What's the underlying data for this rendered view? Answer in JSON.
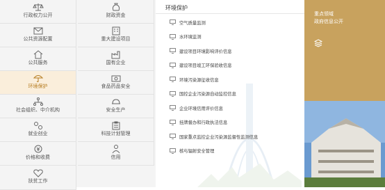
{
  "grid": [
    {
      "label": "行政权力公开",
      "icon": "scale-icon",
      "active": false
    },
    {
      "label": "财政资金",
      "icon": "money-bag-icon",
      "active": false
    },
    {
      "label": "公共资源配置",
      "icon": "envelope-icon",
      "active": false
    },
    {
      "label": "重大建设项目",
      "icon": "building-icon",
      "active": false
    },
    {
      "label": "公共服务",
      "icon": "house-icon",
      "active": false
    },
    {
      "label": "国有企业",
      "icon": "factory-icon",
      "active": false
    },
    {
      "label": "环境保护",
      "icon": "umbrella-icon",
      "active": true
    },
    {
      "label": "食品药品安全",
      "icon": "camera-icon",
      "active": false
    },
    {
      "label": "社会组织、中介机构",
      "icon": "network-icon",
      "active": false
    },
    {
      "label": "安全生产",
      "icon": "hard-hat-icon",
      "active": false
    },
    {
      "label": "就业创业",
      "icon": "gears-icon",
      "active": false
    },
    {
      "label": "科技计划管理",
      "icon": "clipboard-icon",
      "active": false
    },
    {
      "label": "价格和收费",
      "icon": "price-tag-icon",
      "active": false
    },
    {
      "label": "信用",
      "icon": "person-icon",
      "active": false
    },
    {
      "label": "扶贫工作",
      "icon": "heart-icon",
      "active": false
    }
  ],
  "panel": {
    "title": "环境保护",
    "items": [
      "空气质量监测",
      "水环境监测",
      "建设项目环境影响评价信息",
      "建设项目竣工环保验收信息",
      "环境污染源征收信息",
      "国控企业污染源自动监控信息",
      "企业环境信用评价信息",
      "挂牌督办和行政执法信息",
      "国家重点监控企业污染源监督性监测信息",
      "核与辐射安全管理"
    ]
  },
  "side": {
    "line1": "重点领域",
    "line2": "政府信息公开",
    "icon": "layers-icon"
  },
  "colors": {
    "accent": "#c8a25e",
    "active_bg": "#faeedb",
    "active_text": "#b57b1e"
  }
}
